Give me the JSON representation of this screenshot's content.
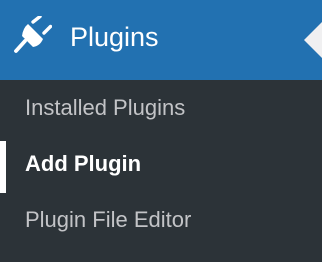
{
  "menu": {
    "title": "Plugins",
    "icon": "plug-icon",
    "colors": {
      "header_background": "#2271b1",
      "menu_background": "#2c3338",
      "item_text": "#c3c4c7",
      "current_text": "#ffffff"
    },
    "items": [
      {
        "label": "Installed Plugins",
        "current": false
      },
      {
        "label": "Add Plugin",
        "current": true
      },
      {
        "label": "Plugin File Editor",
        "current": false
      }
    ]
  }
}
